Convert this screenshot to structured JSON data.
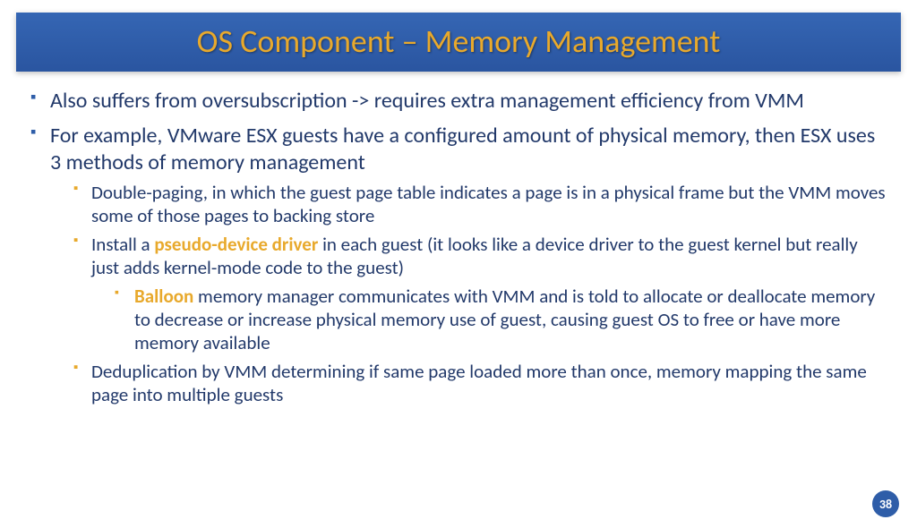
{
  "title": "OS Component – Memory Management",
  "bullets": {
    "b1": "Also suffers from oversubscription -> requires extra management efficiency from VMM",
    "b2": "For example, VMware ESX guests have a configured amount of physical memory, then ESX uses 3 methods of memory management",
    "b2a": "Double-paging, in which the guest page table indicates a page is in a physical frame but the VMM moves some of those pages to backing store",
    "b2b_pre": "Install a ",
    "b2b_hl": "pseudo-device driver",
    "b2b_post": " in each guest (it looks like a device driver to the guest kernel but really just adds kernel-mode code to the guest)",
    "b2b_i_hl": "Balloon",
    "b2b_i_post": " memory manager communicates with VMM and is told to allocate or deallocate memory to decrease or increase physical memory use of guest, causing guest OS to free or have more memory available",
    "b2c": "Deduplication by VMM determining if same page loaded more than once, memory mapping the same page into multiple guests"
  },
  "page_number": "38"
}
